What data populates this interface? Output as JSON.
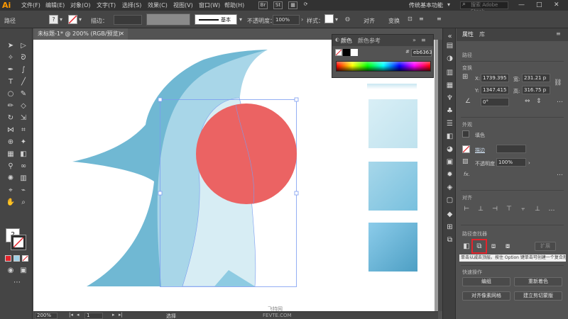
{
  "menubar": {
    "logo": "Ai",
    "items": [
      "文件(F)",
      "编辑(E)",
      "对象(O)",
      "文字(T)",
      "选择(S)",
      "效果(C)",
      "视图(V)",
      "窗口(W)",
      "帮助(H)"
    ],
    "badges": [
      "Br",
      "St"
    ],
    "workspace": "传统基本功能",
    "search_placeholder": "搜索 Adobe Stock",
    "window_controls": [
      "—",
      "□",
      "✕"
    ]
  },
  "controlbar": {
    "selection_label": "路径",
    "stroke_label": "描边：",
    "stroke_style": "基本",
    "opacity_label": "不透明度：",
    "opacity_value": "100%",
    "style_label": "样式：",
    "align_label": "对齐",
    "transform_label": "变换"
  },
  "document": {
    "tab_title": "未标题-1* @ 200% (RGB/预览)",
    "close": "✕",
    "zoom": "200%",
    "page": "1",
    "status": "选择",
    "watermark_small": "飞特网",
    "watermark": "FEVTE.COM"
  },
  "color_panel": {
    "tabs": [
      "颜色",
      "颜色参考"
    ],
    "hex": "eb6363"
  },
  "properties": {
    "tabs": [
      "属性",
      "库"
    ],
    "path_label": "路径",
    "transform_title": "变换",
    "x_label": "X:",
    "x_value": "1739.395",
    "y_label": "Y:",
    "y_value": "1347.415",
    "w_label": "宽:",
    "w_value": "231.21 p",
    "h_label": "高:",
    "h_value": "316.75 p",
    "angle_value": "0°",
    "appearance_title": "外观",
    "fill_label": "填色",
    "stroke_label": "描边",
    "opacity_label": "不透明度",
    "opacity_value": "100%",
    "fx_label": "fx.",
    "align_title": "对齐",
    "pathfinder_title": "路径查找器",
    "pathfinder_expand": "扩展",
    "tooltip": "单击以减去顶层。按住 Option 键单击可创建一个复合形状。",
    "quick_actions_title": "快速操作",
    "btn_edit": "编组",
    "btn_recolor": "重新着色",
    "btn_pixel": "对齐像素网格",
    "btn_clip": "建立剪切蒙版"
  },
  "colors": {
    "accent_red": "#eb6363",
    "bird_dark": "#6ab4cf",
    "bird_light": "#b9e0ec",
    "bird_pale": "#d6ecf3",
    "highlight": "#e4242c"
  }
}
